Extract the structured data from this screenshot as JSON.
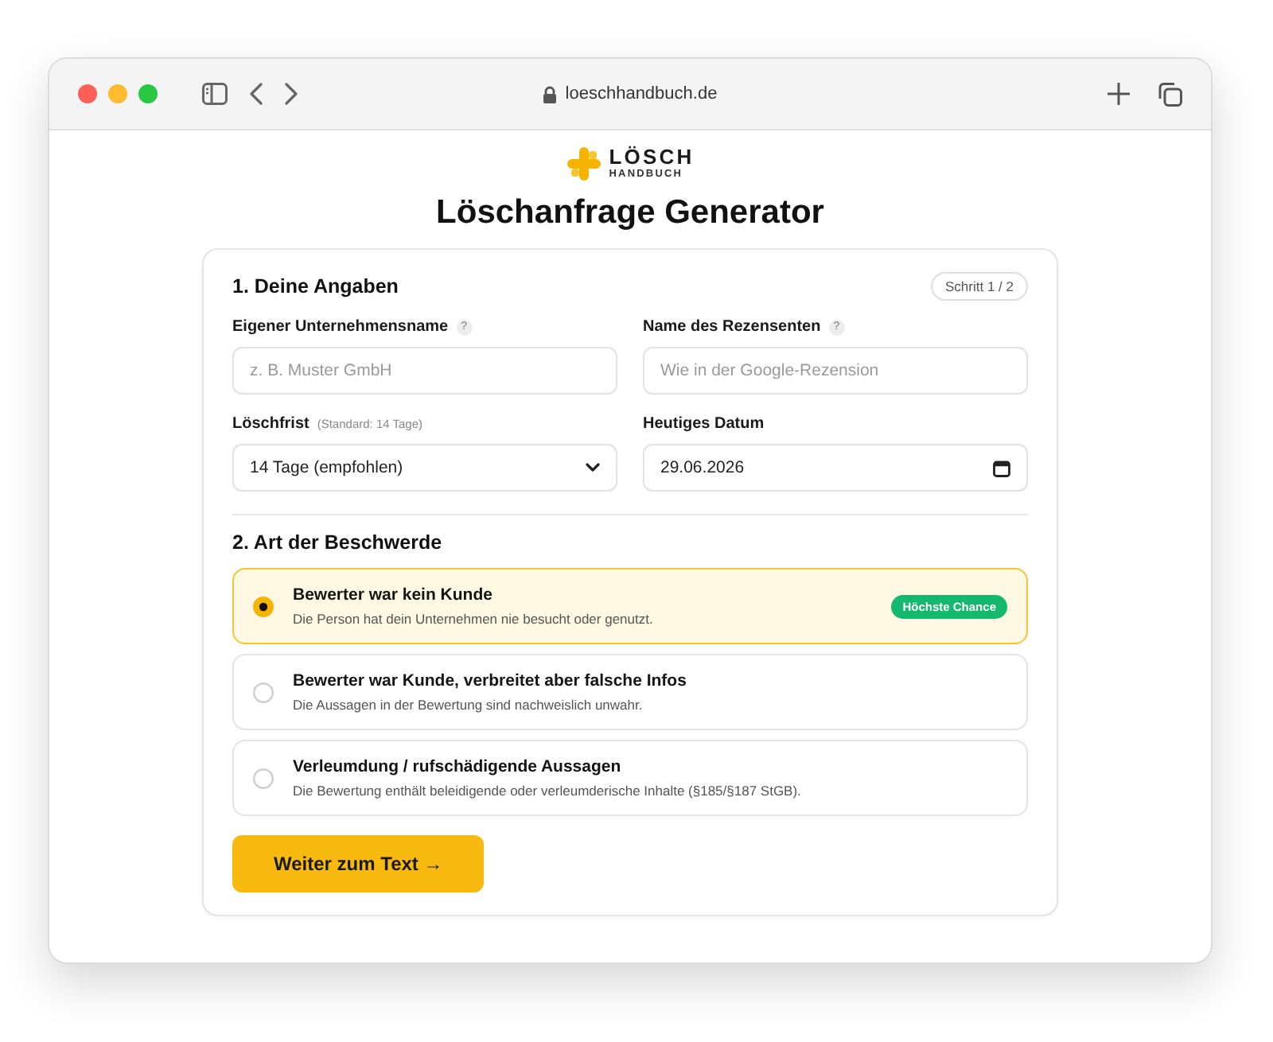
{
  "browser": {
    "url": "loeschhandbuch.de"
  },
  "logo": {
    "wordmark": "LÖSCH",
    "tagline": "HANDBUCH"
  },
  "title": "Löschanfrage Generator",
  "form": {
    "section_1": {
      "heading": "1. Deine Angaben",
      "step": "Schritt 1 / 2"
    },
    "fields": [
      {
        "kind": "text",
        "label": "Eigener Unternehmensname",
        "help": "?",
        "placeholder": "z. B. Muster GmbH"
      },
      {
        "kind": "text",
        "label": "Name des Rezensenten",
        "help": "?",
        "placeholder": "Wie in der Google-Rezension"
      },
      {
        "kind": "select",
        "label": "Löschfrist",
        "hint": "(Standard: 14 Tage)",
        "value": "14 Tage (empfohlen)"
      },
      {
        "kind": "date",
        "label": "Heutiges Datum",
        "value": "29.06.2026"
      }
    ],
    "section_2": {
      "heading": "2. Art der Beschwerde"
    },
    "options": [
      {
        "title": "Bewerter war kein Kunde",
        "description": "Die Person hat dein Unternehmen nie besucht oder genutzt.",
        "badge": "Höchste Chance",
        "selected": true
      },
      {
        "title": "Bewerter war Kunde, verbreitet aber falsche Infos",
        "description": "Die Aussagen in der Bewertung sind nachweislich unwahr.",
        "selected": false
      },
      {
        "title": "Verleumdung / rufschädigende Aussagen",
        "description": "Die Bewertung enthält beleidigende oder verleumderische Inhalte (§185/§187 StGB).",
        "selected": false
      }
    ],
    "submit": "Weiter zum Text →"
  }
}
